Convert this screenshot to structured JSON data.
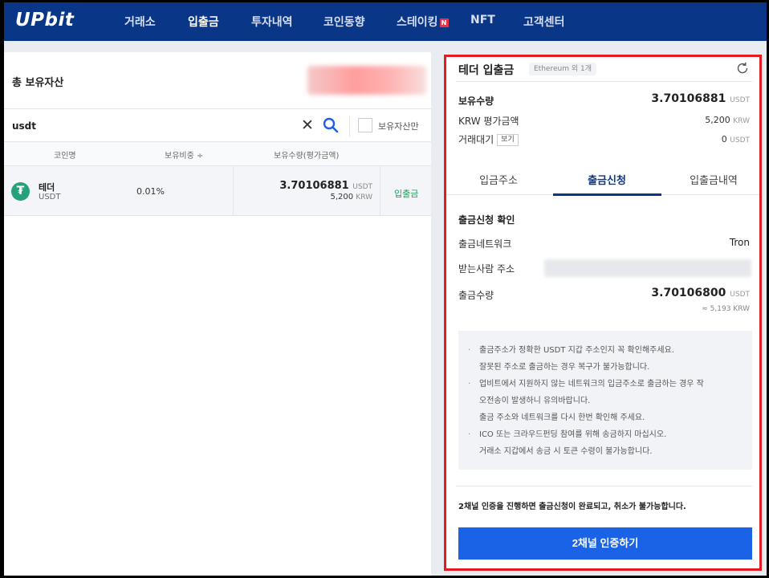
{
  "nav": {
    "logo": "UPbit",
    "items": [
      "거래소",
      "입출금",
      "투자내역",
      "코인동향",
      "스테이킹",
      "NFT",
      "고객센터"
    ],
    "new_badge": "N",
    "active_index": 1
  },
  "holdings": {
    "title": "총 보유자산",
    "search_value": "usdt",
    "only_held_label": "보유자산만",
    "columns": [
      "코인명",
      "보유비중 ÷",
      "보유수량(평가금액)"
    ],
    "row": {
      "name": "테더",
      "symbol": "USDT",
      "ratio": "0.01%",
      "amount": "3.70106881",
      "amount_unit": "USDT",
      "krw": "5,200",
      "krw_unit": "KRW",
      "action": "입출금"
    }
  },
  "panel": {
    "title": "테더 입출금",
    "network_tag": "Ethereum 외 1개",
    "balance_label": "보유수량",
    "balance_value": "3.70106881",
    "balance_unit": "USDT",
    "krw_label": "KRW 평가금액",
    "krw_value": "5,200",
    "krw_unit": "KRW",
    "pending_label": "거래대기",
    "pending_view": "보기",
    "pending_value": "0",
    "pending_unit": "USDT",
    "tabs": [
      "입금주소",
      "출금신청",
      "입출금내역"
    ],
    "active_tab": 1,
    "section_title": "출금신청 확인",
    "network_label": "출금네트워크",
    "network_value": "Tron",
    "address_label": "받는사람 주소",
    "amount_label": "출금수량",
    "amount_value": "3.70106800",
    "amount_unit": "USDT",
    "amount_krw": "≈ 5,193 KRW",
    "notices": [
      {
        "text": "출금주소가 정확한 USDT 지갑 주소인지 꼭 확인해주세요.",
        "bullet": true
      },
      {
        "text": "잘못된 주소로 출금하는 경우 복구가 불가능합니다.",
        "bullet": false
      },
      {
        "text": "업비트에서 지원하지 않는 네트워크의 입금주소로 출금하는 경우 작",
        "bullet": true
      },
      {
        "text": "오전송이 발생하니 유의바랍니다.",
        "bullet": false
      },
      {
        "text": "출금 주소와 네트워크를 다시 한번 확인해 주세요.",
        "bullet": false
      },
      {
        "text": "ICO 또는 크라우드펀딩 참여를 위해 송금하지 마십시오.",
        "bullet": true
      },
      {
        "text": "거래소 지갑에서 송금 시 토큰 수령이 불가능합니다.",
        "bullet": false
      }
    ],
    "confirm_text": "2채널 인증을 진행하면 출금신청이 완료되고, 취소가 불가능합니다.",
    "auth_button": "2채널 인증하기"
  },
  "colors": {
    "nav_bg": "#093687",
    "accent_blue": "#1a63e6",
    "highlight_border": "#e31b23",
    "tether_green": "#26a17b"
  }
}
